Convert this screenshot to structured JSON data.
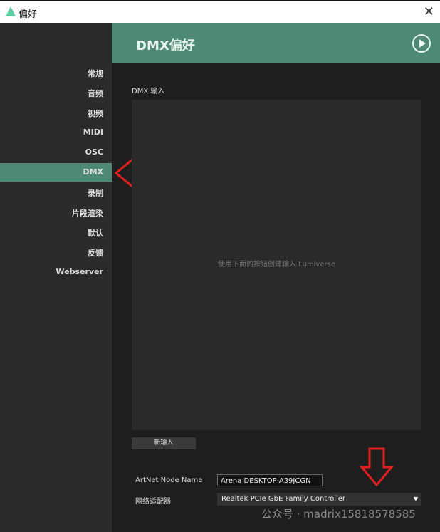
{
  "window": {
    "title": "偏好",
    "close": "✕"
  },
  "sidebar": {
    "items": [
      {
        "label": "常规"
      },
      {
        "label": "音频"
      },
      {
        "label": "视频"
      },
      {
        "label": "MIDI"
      },
      {
        "label": "OSC"
      },
      {
        "label": "DMX",
        "active": true
      },
      {
        "label": "录制"
      },
      {
        "label": "片段渲染"
      },
      {
        "label": "默认"
      },
      {
        "label": "反馈"
      },
      {
        "label": "Webserver"
      }
    ]
  },
  "header": {
    "title": "DMX偏好"
  },
  "dmx_input": {
    "label": "DMX 输入",
    "empty_hint": "使用下面的按钮创建输入 Lumiverse",
    "new_button": "新输入"
  },
  "artnet": {
    "label": "ArtNet Node Name",
    "value": "Arena DESKTOP-A39JCGN"
  },
  "adapter": {
    "label": "网络适配器",
    "value": "Realtek PCIe GbE Family Controller"
  },
  "watermark": "公众号 · madrix15818578585",
  "colors": {
    "accent": "#4e8a73",
    "annotation_arrow": "#e02020"
  }
}
